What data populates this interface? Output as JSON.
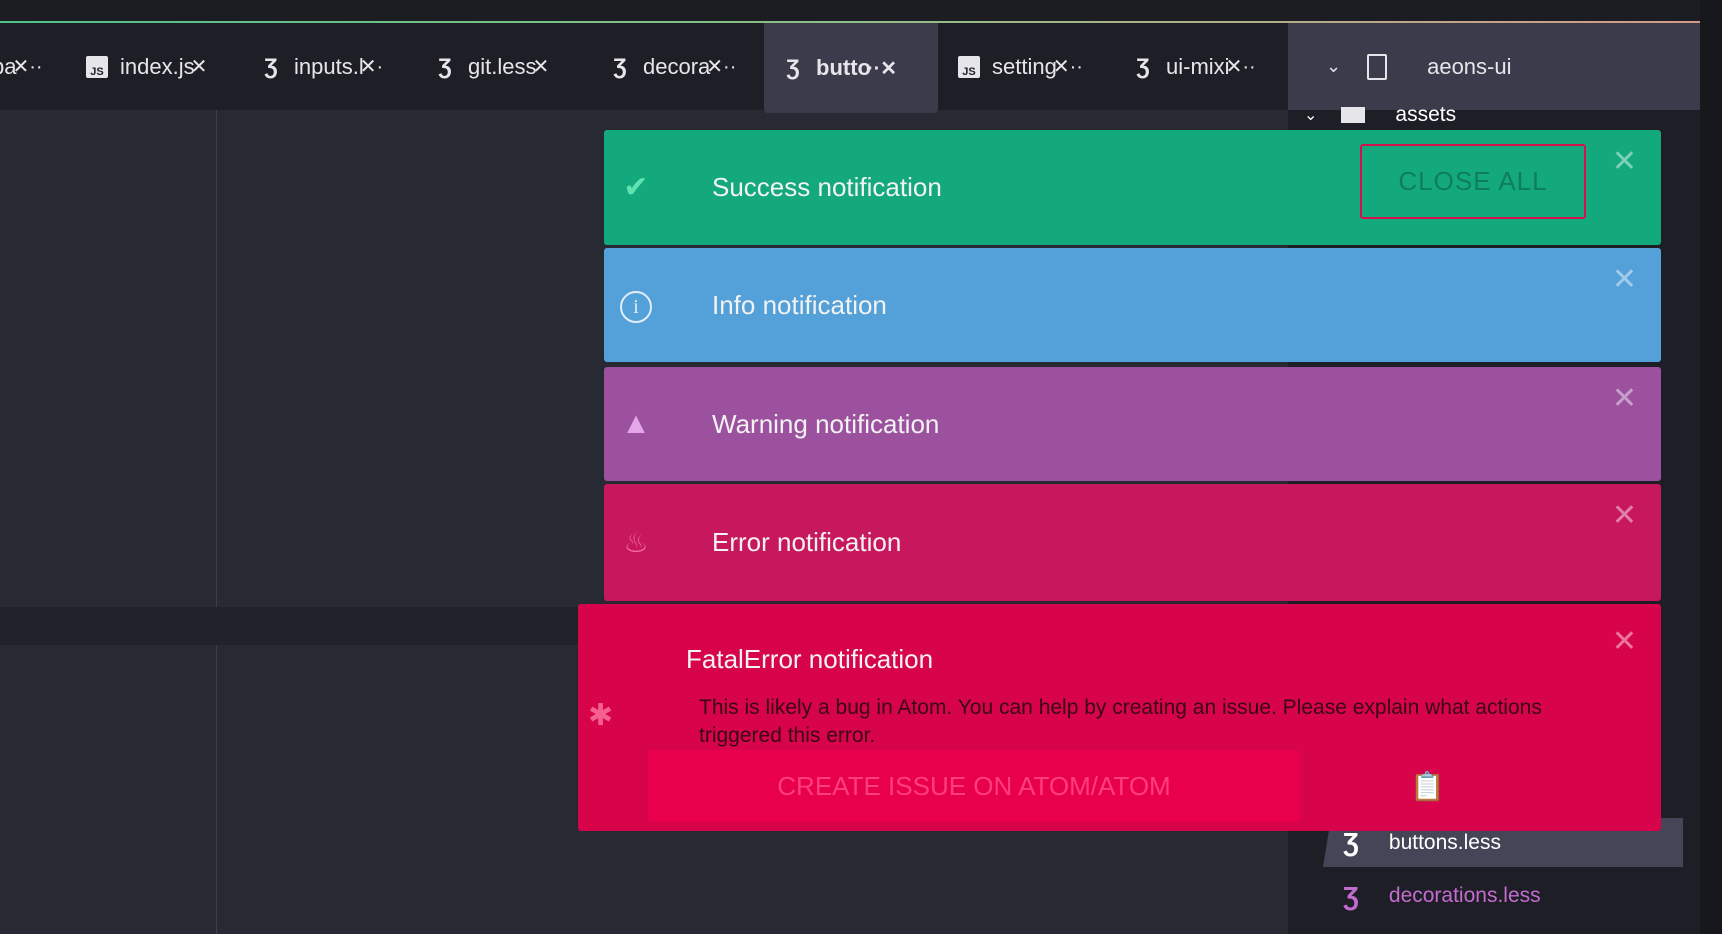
{
  "tabs": [
    {
      "label": "pa",
      "icon": "css-icon"
    },
    {
      "label": "index.js",
      "icon": "js-icon"
    },
    {
      "label": "inputs.l",
      "icon": "css-icon"
    },
    {
      "label": "git.less",
      "icon": "css-icon"
    },
    {
      "label": "decora",
      "icon": "css-icon"
    },
    {
      "label": "butto",
      "icon": "css-icon",
      "active": true
    },
    {
      "label": "setting",
      "icon": "js-icon"
    },
    {
      "label": "ui-mixi",
      "icon": "css-icon"
    }
  ],
  "tree_view": {
    "project": "aeons-ui",
    "items": [
      {
        "label": "assets",
        "icon": "folder-icon"
      },
      {
        "label": "buttons.less",
        "icon": "css-icon",
        "selected": true
      },
      {
        "label": "decorations.less",
        "icon": "css-icon",
        "color": "#c46bd0"
      }
    ]
  },
  "notifications": [
    {
      "type": "success",
      "title": "Success notification",
      "color": "#13a97d",
      "icon": "check-icon",
      "close_all": "CLOSE ALL"
    },
    {
      "type": "info",
      "title": "Info notification",
      "color": "#54a0d8",
      "icon": "info-icon"
    },
    {
      "type": "warning",
      "title": "Warning notification",
      "color": "#9c519f",
      "icon": "warning-icon"
    },
    {
      "type": "error",
      "title": "Error notification",
      "color": "#c7185e",
      "icon": "flame-icon"
    },
    {
      "type": "fatal",
      "title": "FatalError notification",
      "color": "#d7044b",
      "icon": "bug-icon",
      "detail": "This is likely a bug in Atom. You can help by creating an issue. Please explain what actions triggered this error.",
      "button": "CREATE ISSUE ON ATOM/ATOM"
    }
  ]
}
